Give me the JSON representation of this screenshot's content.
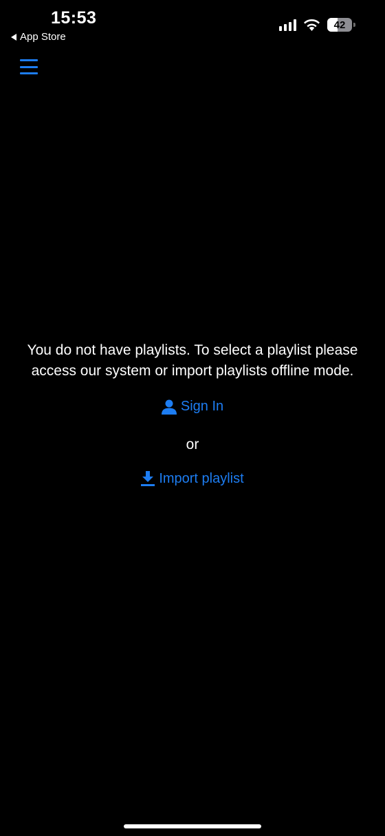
{
  "theme": {
    "background": "#000000",
    "accent": "#1d7df2",
    "text": "#ffffff"
  },
  "status_bar": {
    "time": "15:53",
    "back_label": "App Store",
    "signal_icon": "cellular-signal-icon",
    "wifi_icon": "wifi-icon",
    "battery_level": "42",
    "battery_fraction": 0.42
  },
  "header": {
    "menu_icon": "hamburger-menu-icon"
  },
  "empty_state": {
    "message": "You do not have playlists. To select a playlist please access our system or import playlists offline mode.",
    "sign_in_label": "Sign In",
    "sign_in_icon": "person-icon",
    "or_label": "or",
    "import_label": "Import playlist",
    "import_icon": "download-icon"
  }
}
